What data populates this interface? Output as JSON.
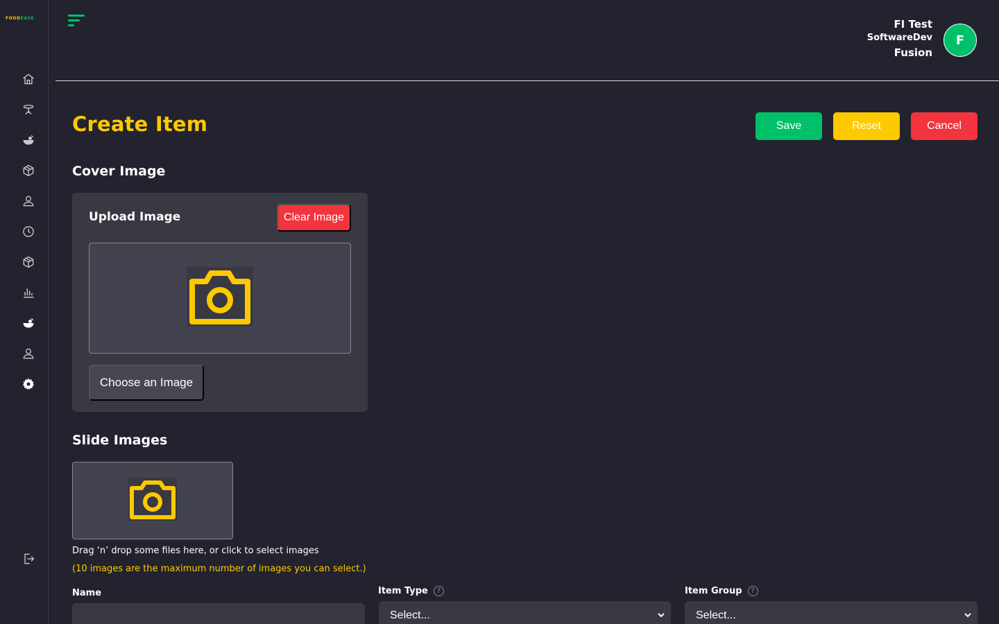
{
  "app": {
    "logo_part1": "FOOD",
    "logo_part2": "EASE"
  },
  "sidebar": {
    "items": [
      {
        "name": "home-icon"
      },
      {
        "name": "table-icon"
      },
      {
        "name": "food-icon"
      },
      {
        "name": "box-icon"
      },
      {
        "name": "user-icon"
      },
      {
        "name": "clock-icon"
      },
      {
        "name": "box-icon"
      },
      {
        "name": "chart-icon"
      },
      {
        "name": "food-icon"
      },
      {
        "name": "user-icon"
      },
      {
        "name": "gear-icon"
      }
    ],
    "logout": {
      "name": "logout-icon"
    }
  },
  "header": {
    "user_name": "FI Test",
    "user_role": "SoftwareDev",
    "user_org": "Fusion",
    "avatar_letter": "F"
  },
  "page": {
    "title": "Create Item",
    "save_label": "Save",
    "reset_label": "Reset",
    "cancel_label": "Cancel"
  },
  "cover": {
    "section_title": "Cover Image",
    "upload_label": "Upload Image",
    "clear_label": "Clear Image",
    "choose_label": "Choose an Image"
  },
  "slides": {
    "section_title": "Slide Images",
    "hint": "Drag ‘n’ drop some files here, or click to select images",
    "max_note": "(10 images are the maximum number of images you can select.)"
  },
  "form": {
    "name_label": "Name",
    "name_value": "",
    "item_type_label": "Item Type",
    "item_type_value": "Select...",
    "item_group_label": "Item Group",
    "item_group_value": "Select..."
  },
  "colors": {
    "background": "#23232f",
    "card": "#393943",
    "accent_yellow": "#fdc900",
    "accent_green": "#00c16a",
    "accent_red": "#f2343e"
  }
}
